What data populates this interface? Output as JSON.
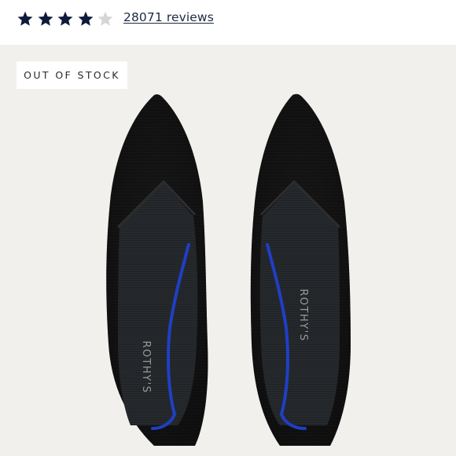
{
  "rating": {
    "value": 4,
    "max": 5,
    "filled_color": "#0e1a3a",
    "empty_color": "#d6d6d6",
    "reviews_label": "28071 reviews"
  },
  "product_image": {
    "badge_label": "OUT OF STOCK",
    "brand_insole_text": "ROTHY'S",
    "background_color": "#f1f0ed",
    "shoe_color": "#141414",
    "piping_color": "#1f3fc4"
  }
}
